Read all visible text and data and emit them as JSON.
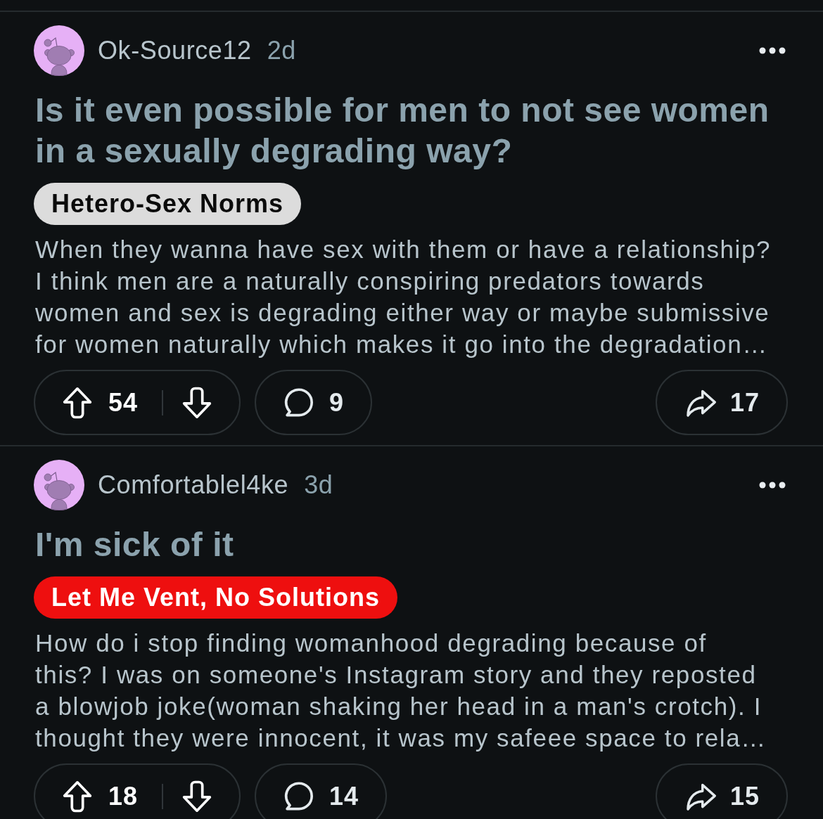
{
  "posts": [
    {
      "author": "Ok-Source12",
      "age": "2d",
      "title": "Is it even possible for men to not see women in a sexually degrading way?",
      "flair": {
        "text": "Hetero-Sex Norms",
        "color": "#dcdcdc"
      },
      "body": "When they wanna have sex with them or have a relationship?\nI think men are a naturally conspiring predators towards\nwomen and sex is degrading either way or maybe submissive\nfor women naturally which makes it go into the degradation…",
      "votes": "54",
      "comments": "9",
      "shares": "17"
    },
    {
      "author": "Comfortablel4ke",
      "age": "3d",
      "title": "I'm sick of it",
      "flair": {
        "text": "Let Me Vent, No Solutions",
        "color": "#ee0f0f"
      },
      "body": "How do i stop finding womanhood degrading because of\nthis? I was on someone's Instagram story and they reposted\na blowjob joke(woman shaking her head in a man's crotch). I\nthought they were innocent, it was my safeee space to rela…",
      "votes": "18",
      "comments": "14",
      "shares": "15"
    }
  ]
}
